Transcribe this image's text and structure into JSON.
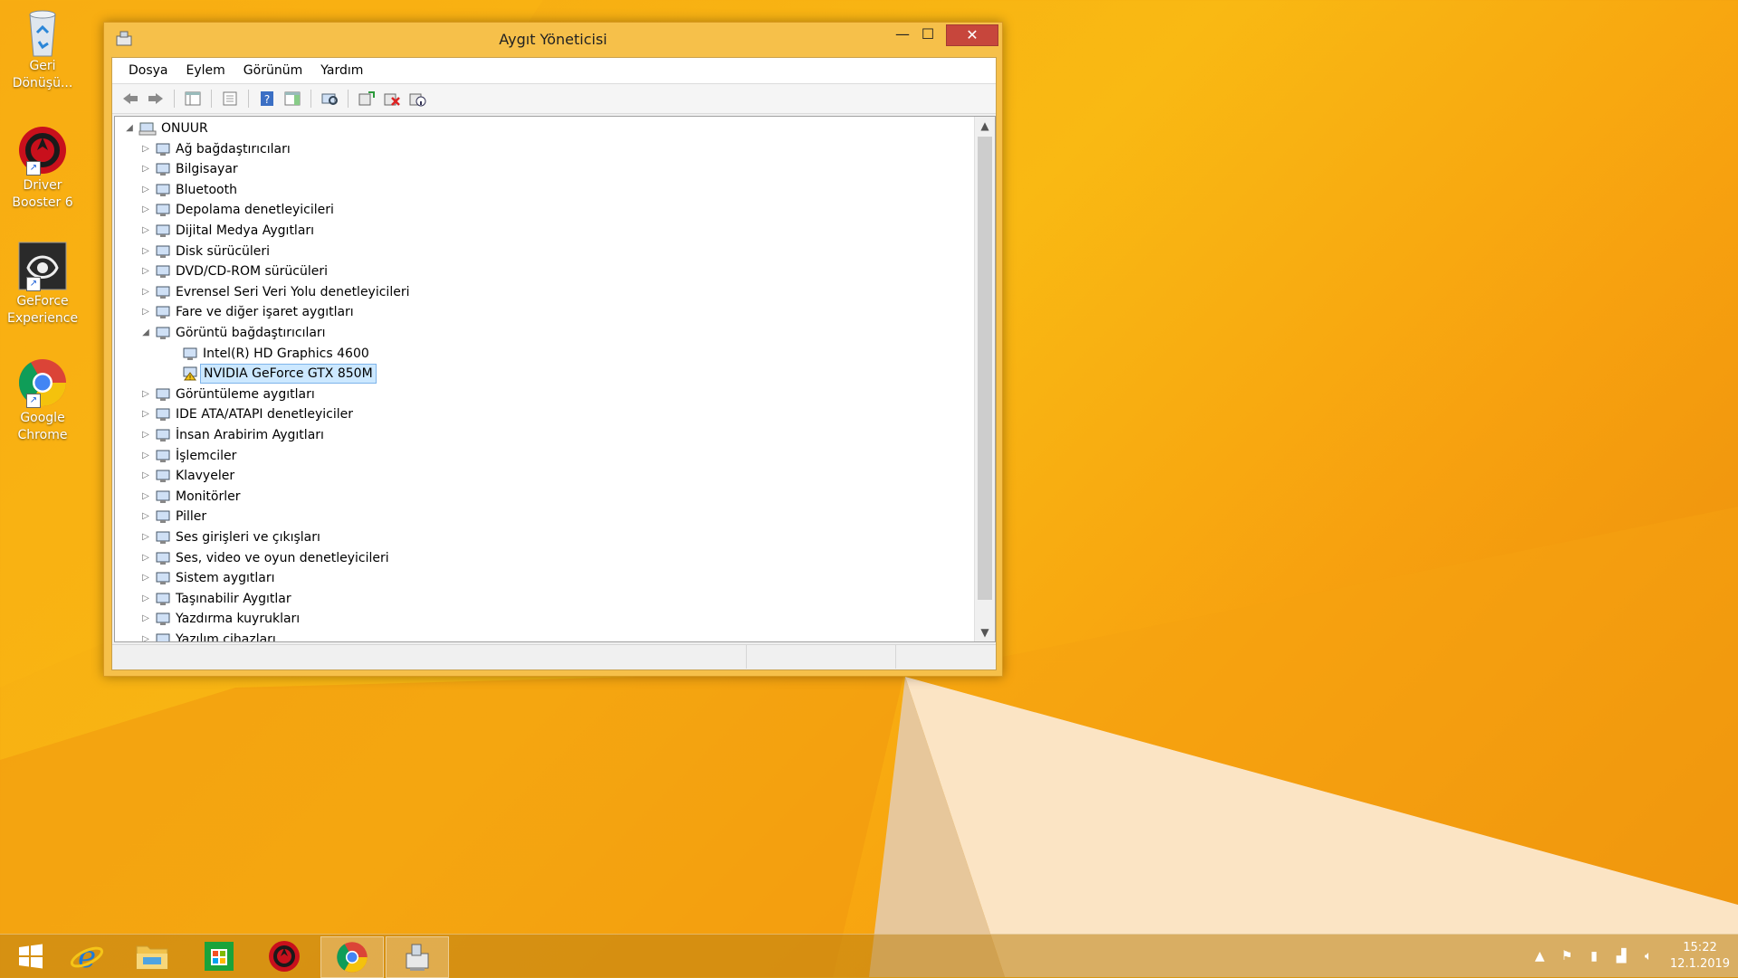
{
  "desktop": {
    "icons": [
      {
        "label": "Geri Dönüşü...",
        "name": "recycle-bin"
      },
      {
        "label": "Driver Booster 6",
        "name": "driver-booster"
      },
      {
        "label": "GeForce Experience",
        "name": "geforce-experience"
      },
      {
        "label": "Google Chrome",
        "name": "google-chrome"
      }
    ]
  },
  "window": {
    "title": "Aygıt Yöneticisi",
    "menu": [
      "Dosya",
      "Eylem",
      "Görünüm",
      "Yardım"
    ],
    "toolbar_icons": [
      "back-icon",
      "forward-icon",
      "show-hide-console-tree-icon",
      "properties-icon",
      "help-icon",
      "show-action-pane-icon",
      "scan-hardware-icon",
      "update-driver-icon",
      "uninstall-device-icon",
      "disable-device-icon"
    ],
    "tree": {
      "root": "ONUUR",
      "categories": [
        {
          "label": "Ağ bağdaştırıcıları",
          "icon": "network-adapter-icon",
          "expanded": false
        },
        {
          "label": "Bilgisayar",
          "icon": "computer-icon",
          "expanded": false
        },
        {
          "label": "Bluetooth",
          "icon": "bluetooth-icon",
          "expanded": false
        },
        {
          "label": "Depolama denetleyicileri",
          "icon": "storage-controller-icon",
          "expanded": false
        },
        {
          "label": "Dijital Medya Aygıtları",
          "icon": "digital-media-icon",
          "expanded": false
        },
        {
          "label": "Disk sürücüleri",
          "icon": "disk-drive-icon",
          "expanded": false
        },
        {
          "label": "DVD/CD-ROM sürücüleri",
          "icon": "dvd-drive-icon",
          "expanded": false
        },
        {
          "label": "Evrensel Seri Veri Yolu denetleyicileri",
          "icon": "usb-icon",
          "expanded": false
        },
        {
          "label": "Fare ve diğer işaret aygıtları",
          "icon": "mouse-icon",
          "expanded": false
        },
        {
          "label": "Görüntü bağdaştırıcıları",
          "icon": "display-adapter-icon",
          "expanded": true,
          "children": [
            {
              "label": "Intel(R) HD Graphics 4600",
              "icon": "display-adapter-icon",
              "warning": false,
              "selected": false
            },
            {
              "label": "NVIDIA GeForce GTX 850M",
              "icon": "display-adapter-warning-icon",
              "warning": true,
              "selected": true
            }
          ]
        },
        {
          "label": "Görüntüleme aygıtları",
          "icon": "imaging-device-icon",
          "expanded": false
        },
        {
          "label": "IDE ATA/ATAPI denetleyiciler",
          "icon": "ide-controller-icon",
          "expanded": false
        },
        {
          "label": "İnsan Arabirim Aygıtları",
          "icon": "hid-icon",
          "expanded": false
        },
        {
          "label": "İşlemciler",
          "icon": "processor-icon",
          "expanded": false
        },
        {
          "label": "Klavyeler",
          "icon": "keyboard-icon",
          "expanded": false
        },
        {
          "label": "Monitörler",
          "icon": "monitor-icon",
          "expanded": false
        },
        {
          "label": "Piller",
          "icon": "battery-icon",
          "expanded": false
        },
        {
          "label": "Ses girişleri ve çıkışları",
          "icon": "audio-io-icon",
          "expanded": false
        },
        {
          "label": "Ses, video ve oyun denetleyicileri",
          "icon": "sound-controller-icon",
          "expanded": false
        },
        {
          "label": "Sistem aygıtları",
          "icon": "system-device-icon",
          "expanded": false
        },
        {
          "label": "Taşınabilir Aygıtlar",
          "icon": "portable-device-icon",
          "expanded": false
        },
        {
          "label": "Yazdırma kuyrukları",
          "icon": "printer-icon",
          "expanded": false
        },
        {
          "label": "Yazılım cihazları",
          "icon": "software-device-icon",
          "expanded": false
        }
      ]
    }
  },
  "taskbar": {
    "apps": [
      "start-button",
      "internet-explorer",
      "file-explorer",
      "windows-store",
      "driver-booster",
      "google-chrome",
      "device-manager"
    ],
    "clock_time": "15:22",
    "clock_date": "12.1.2019"
  },
  "colors": {
    "selection_bg": "#cce8ff",
    "close_button": "#c7463c",
    "window_frame": "#f6c04a",
    "wallpaper": "#f9b913"
  }
}
